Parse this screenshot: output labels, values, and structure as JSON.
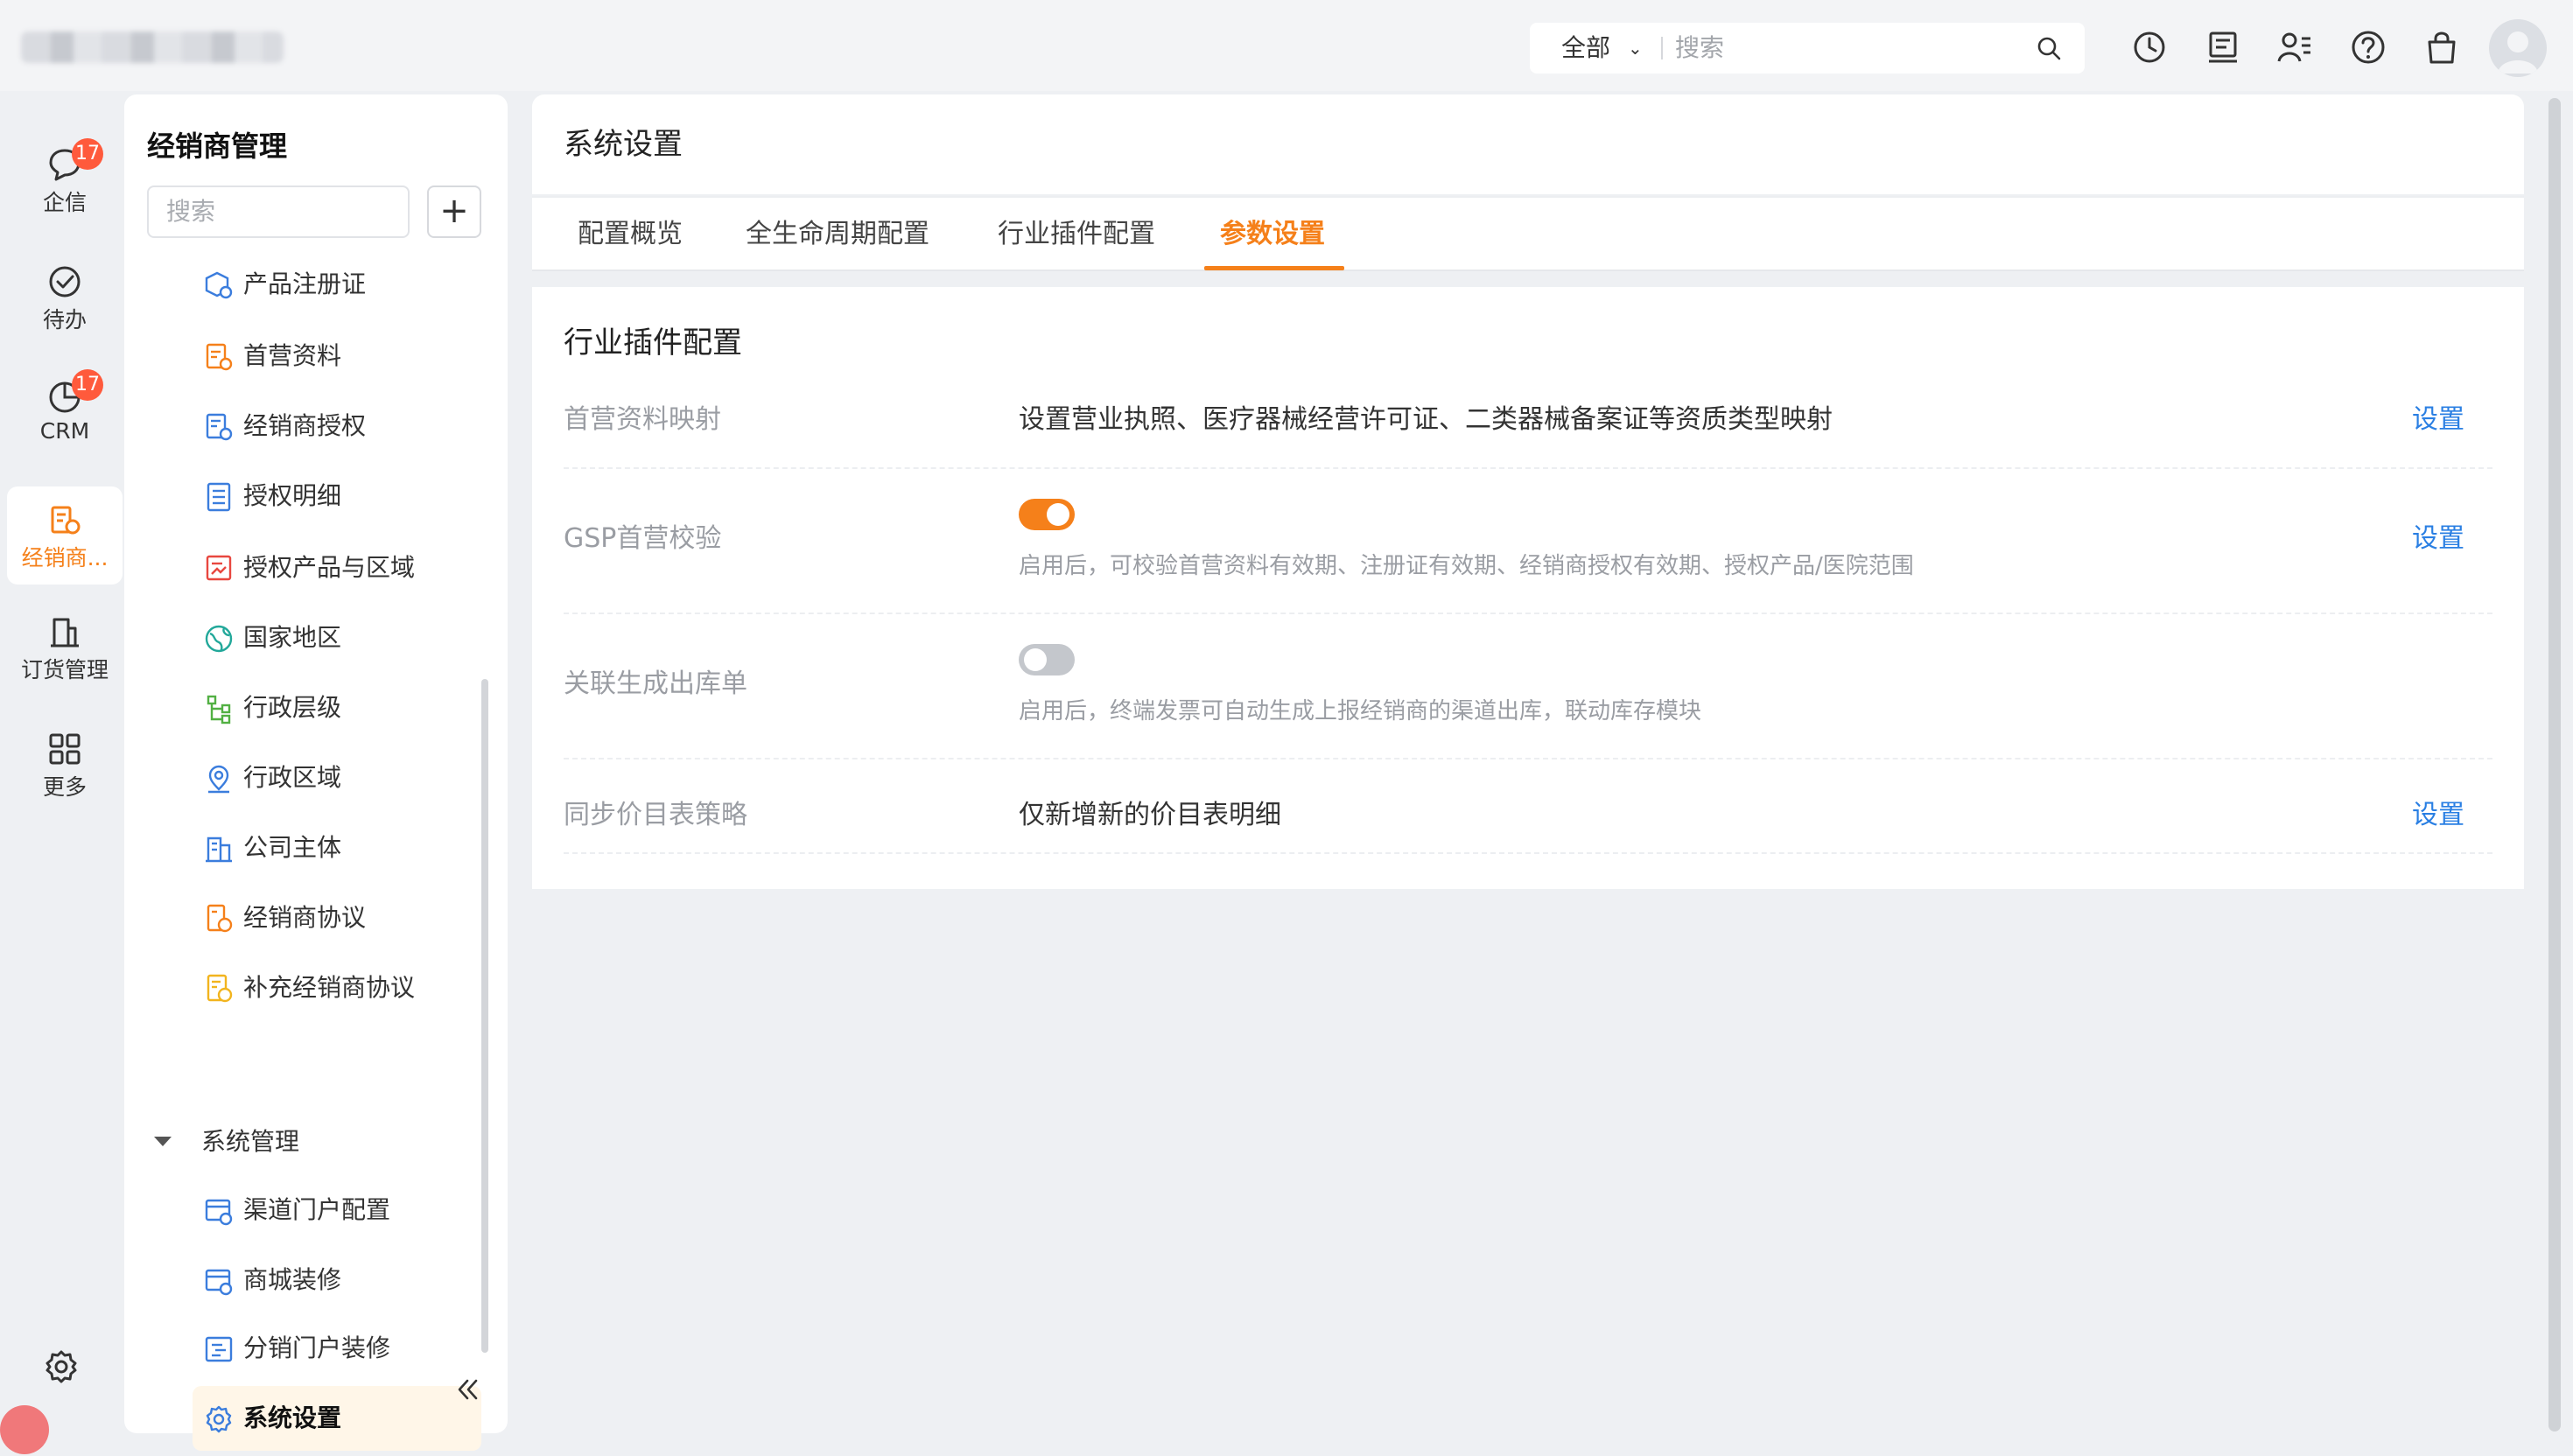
{
  "topbar": {
    "search_scope": "全部",
    "search_placeholder": "搜索"
  },
  "rail": {
    "items": [
      {
        "label": "企信",
        "badge": "17",
        "icon": "chat-icon"
      },
      {
        "label": "待办",
        "icon": "check-circle-icon"
      },
      {
        "label": "CRM",
        "badge": "17",
        "icon": "pie-chart-icon"
      },
      {
        "label": "经销商...",
        "icon": "distributor-icon",
        "active": true
      },
      {
        "label": "订货管理",
        "icon": "building-icon"
      },
      {
        "label": "更多",
        "icon": "grid-icon"
      }
    ]
  },
  "sidebar": {
    "title": "经销商管理",
    "search_placeholder": "搜索",
    "add_label": "+",
    "items": [
      {
        "label": "产品注册证",
        "icon": "product-cert-icon"
      },
      {
        "label": "首营资料",
        "icon": "document-icon"
      },
      {
        "label": "经销商授权",
        "icon": "authorization-icon"
      },
      {
        "label": "授权明细",
        "icon": "list-detail-icon"
      },
      {
        "label": "授权产品与区域",
        "icon": "product-region-icon"
      },
      {
        "label": "国家地区",
        "icon": "globe-icon"
      },
      {
        "label": "行政层级",
        "icon": "hierarchy-icon"
      },
      {
        "label": "行政区域",
        "icon": "location-icon"
      },
      {
        "label": "公司主体",
        "icon": "company-icon"
      },
      {
        "label": "经销商协议",
        "icon": "agreement-icon"
      },
      {
        "label": "补充经销商协议",
        "icon": "supplement-agreement-icon"
      }
    ],
    "group": {
      "label": "系统管理",
      "items": [
        {
          "label": "渠道门户配置",
          "icon": "portal-config-icon"
        },
        {
          "label": "商城装修",
          "icon": "mall-decor-icon"
        },
        {
          "label": "分销门户装修",
          "icon": "distribution-portal-icon"
        },
        {
          "label": "系统设置",
          "icon": "gear-icon",
          "active": true
        }
      ]
    }
  },
  "main": {
    "title": "系统设置",
    "tabs": [
      {
        "label": "配置概览"
      },
      {
        "label": "全生命周期配置"
      },
      {
        "label": "行业插件配置"
      },
      {
        "label": "参数设置",
        "active": true
      }
    ],
    "section_title": "行业插件配置",
    "rows": [
      {
        "label": "首营资料映射",
        "value": "设置营业执照、医疗器械经营许可证、二类器械备案证等资质类型映射",
        "link": "设置"
      },
      {
        "label": "GSP首营校验",
        "toggle": true,
        "description": "启用后，可校验首营资料有效期、注册证有效期、经销商授权有效期、授权产品/医院范围",
        "link": "设置"
      },
      {
        "label": "关联生成出库单",
        "toggle": false,
        "description": "启用后，终端发票可自动生成上报经销商的渠道出库，联动库存模块"
      },
      {
        "label": "同步价目表策略",
        "value": "仅新增新的价目表明细",
        "link": "设置"
      }
    ]
  },
  "colors": {
    "accent": "#f5801a",
    "link": "#2a7fe3",
    "badge": "#ff5a3c",
    "background": "#eef0f3"
  }
}
